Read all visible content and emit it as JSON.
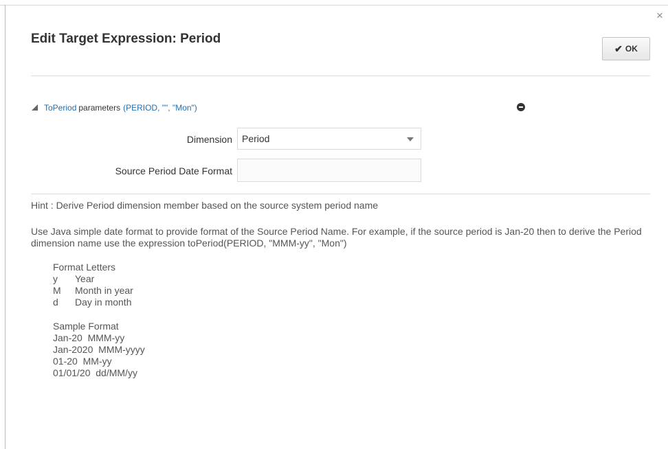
{
  "dialog": {
    "title": "Edit Target Expression: Period",
    "close_glyph": "×",
    "ok_icon": "✔",
    "ok_label": "OK"
  },
  "section": {
    "function_link": "ToPeriod",
    "label": "parameters",
    "params_link": "(PERIOD, \"\", \"Mon\")"
  },
  "form": {
    "dimension_label": "Dimension",
    "dimension_value": "Period",
    "source_format_label": "Source Period Date Format",
    "source_format_value": ""
  },
  "help": {
    "hint": "Hint : Derive Period dimension member based on the source system period name",
    "description": "Use Java simple date format to provide format of the Source Period Name. For example, if the source period is Jan-20 then to derive the Period dimension name use the expression toPeriod(PERIOD, \"MMM-yy\", \"Mon\")",
    "format_letters_title": "Format Letters",
    "format_letters": [
      {
        "letter": "y",
        "meaning": "Year"
      },
      {
        "letter": "M",
        "meaning": "Month in year"
      },
      {
        "letter": "d",
        "meaning": "Day in month"
      }
    ],
    "sample_format_title": "Sample Format",
    "samples": [
      "Jan-20  MMM-yy",
      "Jan-2020  MMM-yyyy",
      "01-20  MM-yy",
      "01/01/20  dd/MM/yy"
    ]
  },
  "icons": {
    "close": "close-icon",
    "ok_check": "check-icon",
    "expand": "triangle-expanded-icon",
    "remove": "remove-circle-icon",
    "dropdown": "chevron-down-icon"
  },
  "colors": {
    "link": "#1f6fb2",
    "text": "#333333",
    "muted_text": "#555555"
  }
}
